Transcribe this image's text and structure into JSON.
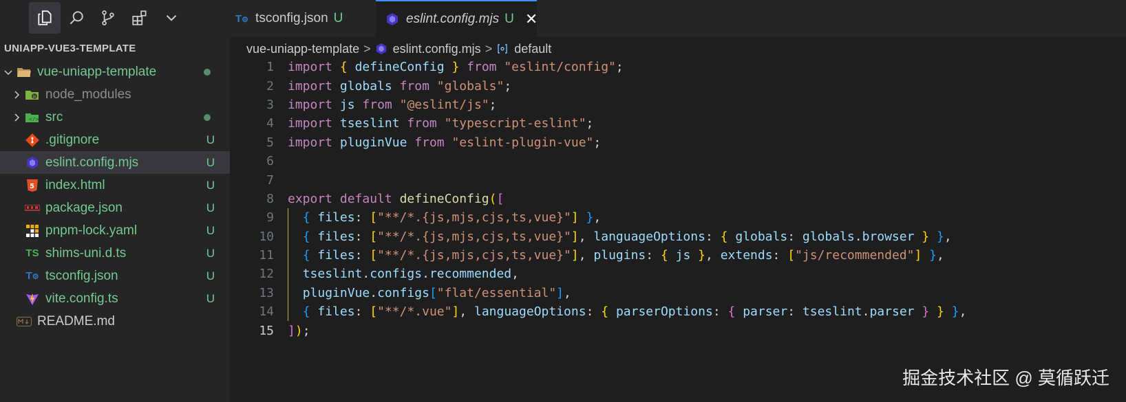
{
  "sidebar": {
    "activity_icons": [
      "explorer-icon",
      "search-icon",
      "source-control-icon",
      "extensions-icon",
      "chevron-down-icon"
    ],
    "explorer_title": "UNIAPP-VUE3-TEMPLATE",
    "items": [
      {
        "label": "vue-uniapp-template",
        "icon": "folder-open-icon",
        "status": "",
        "modified_dot": true
      },
      {
        "label": "node_modules",
        "icon": "node-folder-icon",
        "status": "",
        "modified_dot": false
      },
      {
        "label": "src",
        "icon": "src-folder-icon",
        "status": "",
        "modified_dot": true
      },
      {
        "label": ".gitignore",
        "icon": "git-icon",
        "status": "U"
      },
      {
        "label": "eslint.config.mjs",
        "icon": "eslint-icon",
        "status": "U"
      },
      {
        "label": "index.html",
        "icon": "html5-icon",
        "status": "U"
      },
      {
        "label": "package.json",
        "icon": "npm-icon",
        "status": "U"
      },
      {
        "label": "pnpm-lock.yaml",
        "icon": "pnpm-icon",
        "status": "U"
      },
      {
        "label": "shims-uni.d.ts",
        "icon": "typescript-icon",
        "status": "U"
      },
      {
        "label": "tsconfig.json",
        "icon": "tsconfig-icon",
        "status": "U"
      },
      {
        "label": "vite.config.ts",
        "icon": "vite-icon",
        "status": "U"
      },
      {
        "label": "README.md",
        "icon": "markdown-icon",
        "status": ""
      }
    ]
  },
  "tabs": [
    {
      "name": "tsconfig.json",
      "status": "U",
      "icon": "tsconfig-icon"
    },
    {
      "name": "eslint.config.mjs",
      "status": "U",
      "icon": "eslint-icon",
      "close": "✕"
    }
  ],
  "breadcrumb": {
    "folder": "vue-uniapp-template",
    "file": "eslint.config.mjs",
    "symbol": "default",
    "separator": ">"
  },
  "editor": {
    "line_numbers": [
      "1",
      "2",
      "3",
      "4",
      "5",
      "6",
      "7",
      "8",
      "9",
      "10",
      "11",
      "12",
      "13",
      "14",
      "15"
    ],
    "current_line": "15"
  },
  "watermark": "掘金技术社区 @ 莫循跃迁",
  "colors": {
    "keyword": "#c586c0",
    "variable": "#9cdcfe",
    "function": "#dcdcaa",
    "string": "#ce9178",
    "untracked": "#73c991",
    "accent": "#3794ff"
  }
}
